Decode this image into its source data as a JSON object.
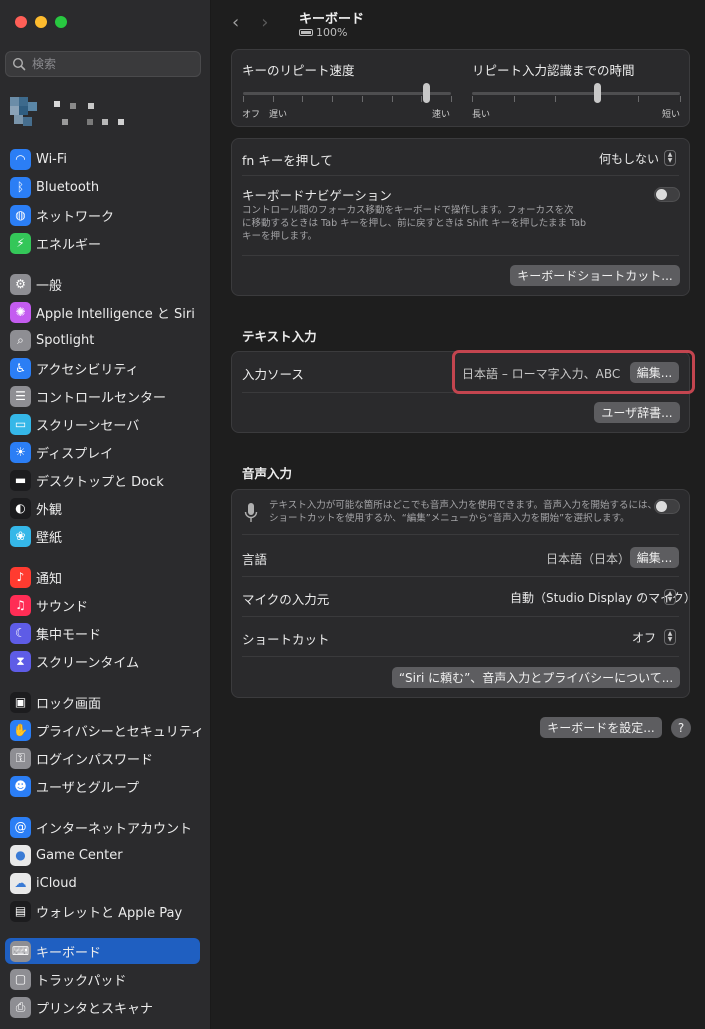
{
  "window": {
    "title": "キーボード",
    "battery": "100%"
  },
  "search": {
    "placeholder": "検索"
  },
  "sidebar": {
    "items": [
      {
        "label": "Wi-Fi",
        "icon": "wifi-icon",
        "color": "#2b7ef5"
      },
      {
        "label": "Bluetooth",
        "icon": "bluetooth-icon",
        "color": "#2b7ef5"
      },
      {
        "label": "ネットワーク",
        "icon": "globe-icon",
        "color": "#2b7ef5"
      },
      {
        "label": "エネルギー",
        "icon": "bolt-icon",
        "color": "#34c759"
      },
      {
        "label": "一般",
        "icon": "gear-icon",
        "color": "#8e8e93"
      },
      {
        "label": "Apple Intelligence と Siri",
        "icon": "siri-icon",
        "color": "#c45cf0"
      },
      {
        "label": "Spotlight",
        "icon": "magnifier-icon",
        "color": "#8e8e93"
      },
      {
        "label": "アクセシビリティ",
        "icon": "accessibility-icon",
        "color": "#2b7ef5"
      },
      {
        "label": "コントロールセンター",
        "icon": "control-center-icon",
        "color": "#8e8e93"
      },
      {
        "label": "スクリーンセーバ",
        "icon": "screensaver-icon",
        "color": "#35b7e8"
      },
      {
        "label": "ディスプレイ",
        "icon": "sun-icon",
        "color": "#2b7ef5"
      },
      {
        "label": "デスクトップと Dock",
        "icon": "dock-icon",
        "color": "#1c1c1e"
      },
      {
        "label": "外観",
        "icon": "appearance-icon",
        "color": "#1c1c1e"
      },
      {
        "label": "壁紙",
        "icon": "wallpaper-icon",
        "color": "#35b7e8"
      },
      {
        "label": "通知",
        "icon": "bell-icon",
        "color": "#ff3b30"
      },
      {
        "label": "サウンド",
        "icon": "speaker-icon",
        "color": "#ff2d55"
      },
      {
        "label": "集中モード",
        "icon": "moon-icon",
        "color": "#5e5ce6"
      },
      {
        "label": "スクリーンタイム",
        "icon": "hourglass-icon",
        "color": "#5e5ce6"
      },
      {
        "label": "ロック画面",
        "icon": "lock-screen-icon",
        "color": "#1c1c1e"
      },
      {
        "label": "プライバシーとセキュリティ",
        "icon": "hand-icon",
        "color": "#2b7ef5"
      },
      {
        "label": "ログインパスワード",
        "icon": "lock-icon",
        "color": "#8e8e93"
      },
      {
        "label": "ユーザとグループ",
        "icon": "users-icon",
        "color": "#2b7ef5"
      },
      {
        "label": "インターネットアカウント",
        "icon": "at-icon",
        "color": "#2b7ef5"
      },
      {
        "label": "Game Center",
        "icon": "game-center-icon",
        "color": "#e9e9e9"
      },
      {
        "label": "iCloud",
        "icon": "cloud-icon",
        "color": "#e9e9e9"
      },
      {
        "label": "ウォレットと Apple Pay",
        "icon": "wallet-icon",
        "color": "#1c1c1e"
      },
      {
        "label": "キーボード",
        "icon": "keyboard-icon",
        "color": "#8e8e93",
        "active": true
      },
      {
        "label": "トラックパッド",
        "icon": "trackpad-icon",
        "color": "#8e8e93"
      },
      {
        "label": "プリンタとスキャナ",
        "icon": "printer-icon",
        "color": "#8e8e93"
      }
    ]
  },
  "repeat": {
    "speed_label": "キーのリピート速度",
    "speed_min": "オフ",
    "speed_slow": "遅い",
    "speed_fast": "速い",
    "speed_value": 0.88,
    "delay_label": "リピート入力認識までの時間",
    "delay_min": "長い",
    "delay_max": "短い",
    "delay_value": 0.6
  },
  "keys": {
    "fn_label": "fn キーを押して",
    "fn_value": "何もしない",
    "nav_label": "キーボードナビゲーション",
    "nav_desc_1": "コントロール間のフォーカス移動をキーボードで操作します。フォーカスを次",
    "nav_desc_2": "に移動するときは Tab キーを押し、前に戻すときは Shift キーを押したまま Tab",
    "nav_desc_3": "キーを押します。",
    "shortcuts_button": "キーボードショートカット..."
  },
  "text_input": {
    "section_title": "テキスト入力",
    "input_source_label": "入力ソース",
    "input_source_value": "日本語 – ローマ字入力、ABC",
    "edit_button": "編集...",
    "dictionary_button": "ユーザ辞書..."
  },
  "dictation": {
    "section_title": "音声入力",
    "desc_1": "テキスト入力が可能な箇所はどこでも音声入力を使用できます。音声入力を開始するには、",
    "desc_2": "ショートカットを使用するか、“編集”メニューから“音声入力を開始”を選択します。",
    "language_label": "言語",
    "language_value": "日本語（日本）",
    "language_edit": "編集...",
    "mic_label": "マイクの入力元",
    "mic_value": "自動（Studio Display のマイク）",
    "shortcut_label": "ショートカット",
    "shortcut_value": "オフ",
    "about_button": "“Siri に頼む”、音声入力とプライバシーについて..."
  },
  "footer": {
    "setup_button": "キーボードを設定...",
    "help": "?"
  }
}
